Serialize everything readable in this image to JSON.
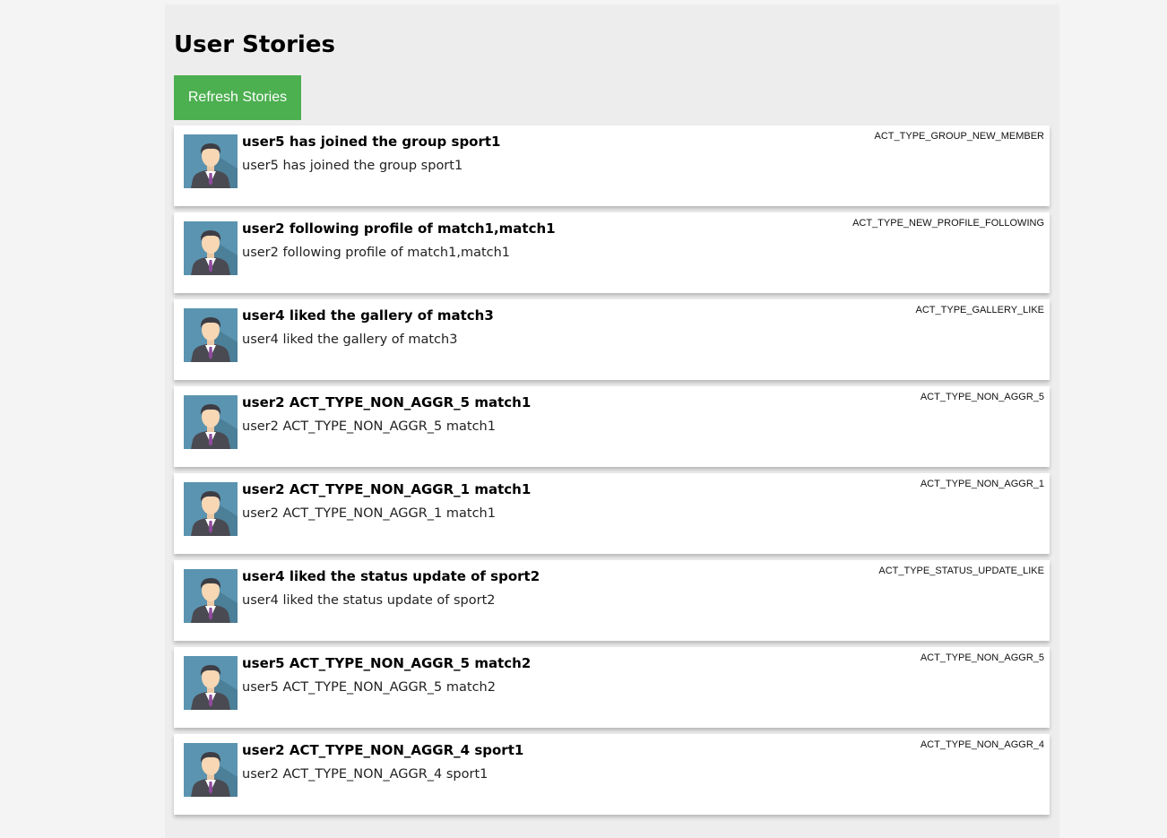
{
  "page": {
    "title": "User Stories",
    "refresh_label": "Refresh Stories"
  },
  "colors": {
    "button": "#4caf50",
    "panel": "#ededed",
    "card": "#ffffff"
  },
  "stories": [
    {
      "title": "user5 has joined the group sport1",
      "body": "user5 has joined the group sport1",
      "type": "ACT_TYPE_GROUP_NEW_MEMBER",
      "icon": "user-avatar-icon"
    },
    {
      "title": "user2 following profile of match1,match1",
      "body": "user2 following profile of match1,match1",
      "type": "ACT_TYPE_NEW_PROFILE_FOLLOWING",
      "icon": "user-avatar-icon"
    },
    {
      "title": "user4 liked the gallery of match3",
      "body": "user4 liked the gallery of match3",
      "type": "ACT_TYPE_GALLERY_LIKE",
      "icon": "user-avatar-icon"
    },
    {
      "title": "user2 ACT_TYPE_NON_AGGR_5 match1",
      "body": "user2 ACT_TYPE_NON_AGGR_5 match1",
      "type": "ACT_TYPE_NON_AGGR_5",
      "icon": "user-avatar-icon"
    },
    {
      "title": "user2 ACT_TYPE_NON_AGGR_1 match1",
      "body": "user2 ACT_TYPE_NON_AGGR_1 match1",
      "type": "ACT_TYPE_NON_AGGR_1",
      "icon": "user-avatar-icon"
    },
    {
      "title": "user4 liked the status update of sport2",
      "body": "user4 liked the status update of sport2",
      "type": "ACT_TYPE_STATUS_UPDATE_LIKE",
      "icon": "user-avatar-icon"
    },
    {
      "title": "user5 ACT_TYPE_NON_AGGR_5 match2",
      "body": "user5 ACT_TYPE_NON_AGGR_5 match2",
      "type": "ACT_TYPE_NON_AGGR_5",
      "icon": "user-avatar-icon"
    },
    {
      "title": "user2 ACT_TYPE_NON_AGGR_4 sport1",
      "body": "user2 ACT_TYPE_NON_AGGR_4 sport1",
      "type": "ACT_TYPE_NON_AGGR_4",
      "icon": "user-avatar-icon"
    }
  ]
}
